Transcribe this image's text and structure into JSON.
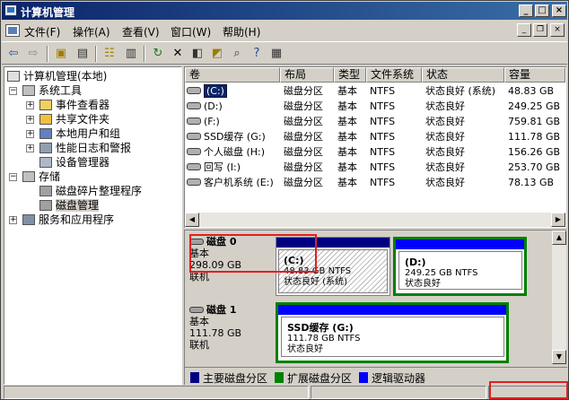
{
  "window": {
    "title": "计算机管理"
  },
  "menu": {
    "items": [
      "文件(F)",
      "操作(A)",
      "查看(V)",
      "窗口(W)",
      "帮助(H)"
    ]
  },
  "toolbar": {
    "icons": [
      "back-icon",
      "forward-icon",
      "up-folder-icon",
      "show-tree-icon",
      "properties-icon",
      "console-icon",
      "refresh-icon",
      "delete-icon",
      "rescan-icon",
      "open-icon",
      "search-icon",
      "help-icon",
      "extra-icon"
    ]
  },
  "tree": {
    "root": "计算机管理(本地)",
    "system_tools": "系统工具",
    "event_viewer": "事件查看器",
    "shared_folders": "共享文件夹",
    "local_users": "本地用户和组",
    "perf_logs": "性能日志和警报",
    "device_manager": "设备管理器",
    "storage": "存储",
    "defrag": "磁盘碎片整理程序",
    "disk_mgmt": "磁盘管理",
    "services": "服务和应用程序"
  },
  "volume_list": {
    "columns": [
      "卷",
      "布局",
      "类型",
      "文件系统",
      "状态",
      "容量"
    ],
    "rows": [
      {
        "volume": "(C:)",
        "layout": "磁盘分区",
        "type": "基本",
        "fs": "NTFS",
        "status": "状态良好 (系统)",
        "capacity": "48.83 GB",
        "selected": true
      },
      {
        "volume": "(D:)",
        "layout": "磁盘分区",
        "type": "基本",
        "fs": "NTFS",
        "status": "状态良好",
        "capacity": "249.25 GB"
      },
      {
        "volume": "(F:)",
        "layout": "磁盘分区",
        "type": "基本",
        "fs": "NTFS",
        "status": "状态良好",
        "capacity": "759.81 GB"
      },
      {
        "volume": "SSD缓存 (G:)",
        "layout": "磁盘分区",
        "type": "基本",
        "fs": "NTFS",
        "status": "状态良好",
        "capacity": "111.78 GB"
      },
      {
        "volume": "个人磁盘 (H:)",
        "layout": "磁盘分区",
        "type": "基本",
        "fs": "NTFS",
        "status": "状态良好",
        "capacity": "156.26 GB"
      },
      {
        "volume": "回写 (I:)",
        "layout": "磁盘分区",
        "type": "基本",
        "fs": "NTFS",
        "status": "状态良好",
        "capacity": "253.70 GB"
      },
      {
        "volume": "客户机系统 (E:)",
        "layout": "磁盘分区",
        "type": "基本",
        "fs": "NTFS",
        "status": "状态良好",
        "capacity": "78.13 GB"
      }
    ]
  },
  "disks": [
    {
      "name": "磁盘 0",
      "type": "基本",
      "size": "298.09 GB",
      "state": "联机",
      "partitions": [
        {
          "label": "(C:)",
          "size": "48.83 GB NTFS",
          "status": "状态良好 (系统)"
        },
        {
          "label": "(D:)",
          "size": "249.25 GB NTFS",
          "status": "状态良好"
        }
      ]
    },
    {
      "name": "磁盘 1",
      "type": "基本",
      "size": "111.78 GB",
      "state": "联机",
      "partitions": [
        {
          "label": "SSD缓存  (G:)",
          "size": "111.78 GB NTFS",
          "status": "状态良好"
        }
      ]
    }
  ],
  "legend": {
    "primary": "主要磁盘分区",
    "extended": "扩展磁盘分区",
    "logical": "逻辑驱动器"
  },
  "colors": {
    "primary": "#000080",
    "extended": "#008000",
    "logical": "#0000ff",
    "annotation": "#e02020"
  }
}
